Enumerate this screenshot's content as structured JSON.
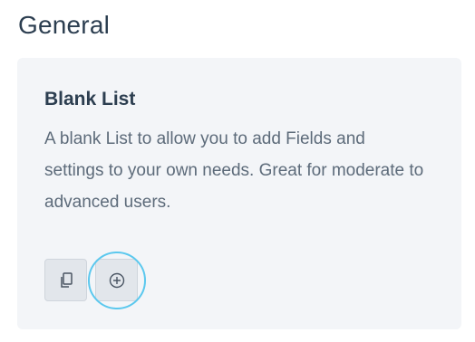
{
  "section": {
    "title": "General"
  },
  "card": {
    "title": "Blank List",
    "description": "A blank List to allow you to add Fields and settings to your own needs. Great for moderate to advanced users.",
    "actions": [
      {
        "icon": "duplicate-icon"
      },
      {
        "icon": "plus-circle-icon"
      }
    ]
  },
  "colors": {
    "card_background": "#f3f5f8",
    "heading": "#2c3e50",
    "body_text": "#5d6b7a",
    "button_background": "#e2e6eb",
    "focus_ring": "#5bc8ee"
  }
}
